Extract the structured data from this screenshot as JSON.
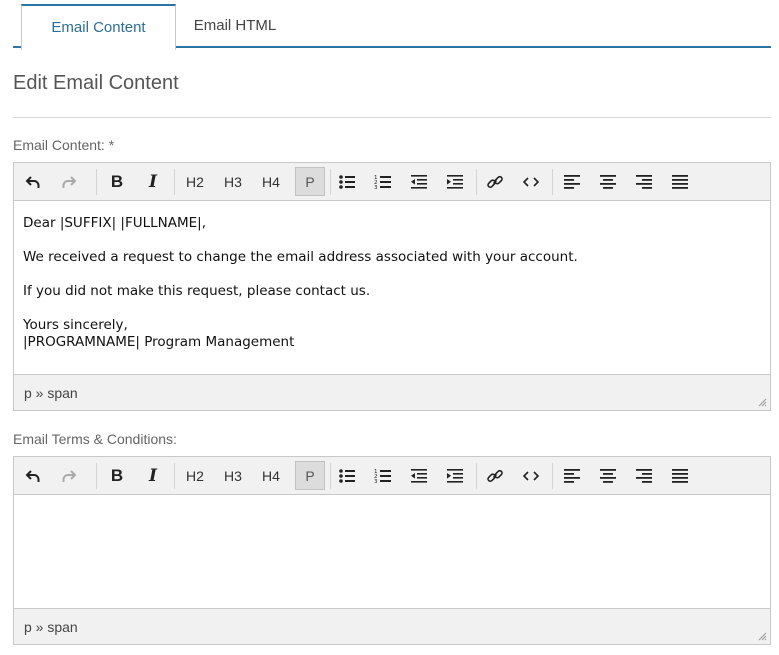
{
  "tabs": [
    {
      "label": "Email Content",
      "active": true
    },
    {
      "label": "Email HTML",
      "active": false
    }
  ],
  "page_title": "Edit Email Content",
  "editors": [
    {
      "label": "Email Content: *",
      "body": [
        "Dear |SUFFIX| |FULLNAME|,",
        "We received a request to change the email address associated with your account.",
        "If you did not make this request, please contact us.",
        "Yours sincerely,\n|PROGRAMNAME| Program Management"
      ],
      "status_path": "p » span"
    },
    {
      "label": "Email Terms & Conditions:",
      "body": [],
      "status_path": "p » span"
    }
  ],
  "toolbar": {
    "h2": "H2",
    "h3": "H3",
    "h4": "H4",
    "p": "P",
    "bold": "B",
    "italic": "I"
  },
  "icons": [
    "undo-icon",
    "redo-icon",
    "bold-icon",
    "italic-icon",
    "bullet-list-icon",
    "numbered-list-icon",
    "outdent-icon",
    "indent-icon",
    "link-icon",
    "code-icon",
    "align-left-icon",
    "align-center-icon",
    "align-right-icon",
    "align-justify-icon"
  ],
  "colors": {
    "accent": "#2a74a6",
    "tab_active_text": "#2a6f9c",
    "toolbar_bg": "#f1f1f1"
  }
}
